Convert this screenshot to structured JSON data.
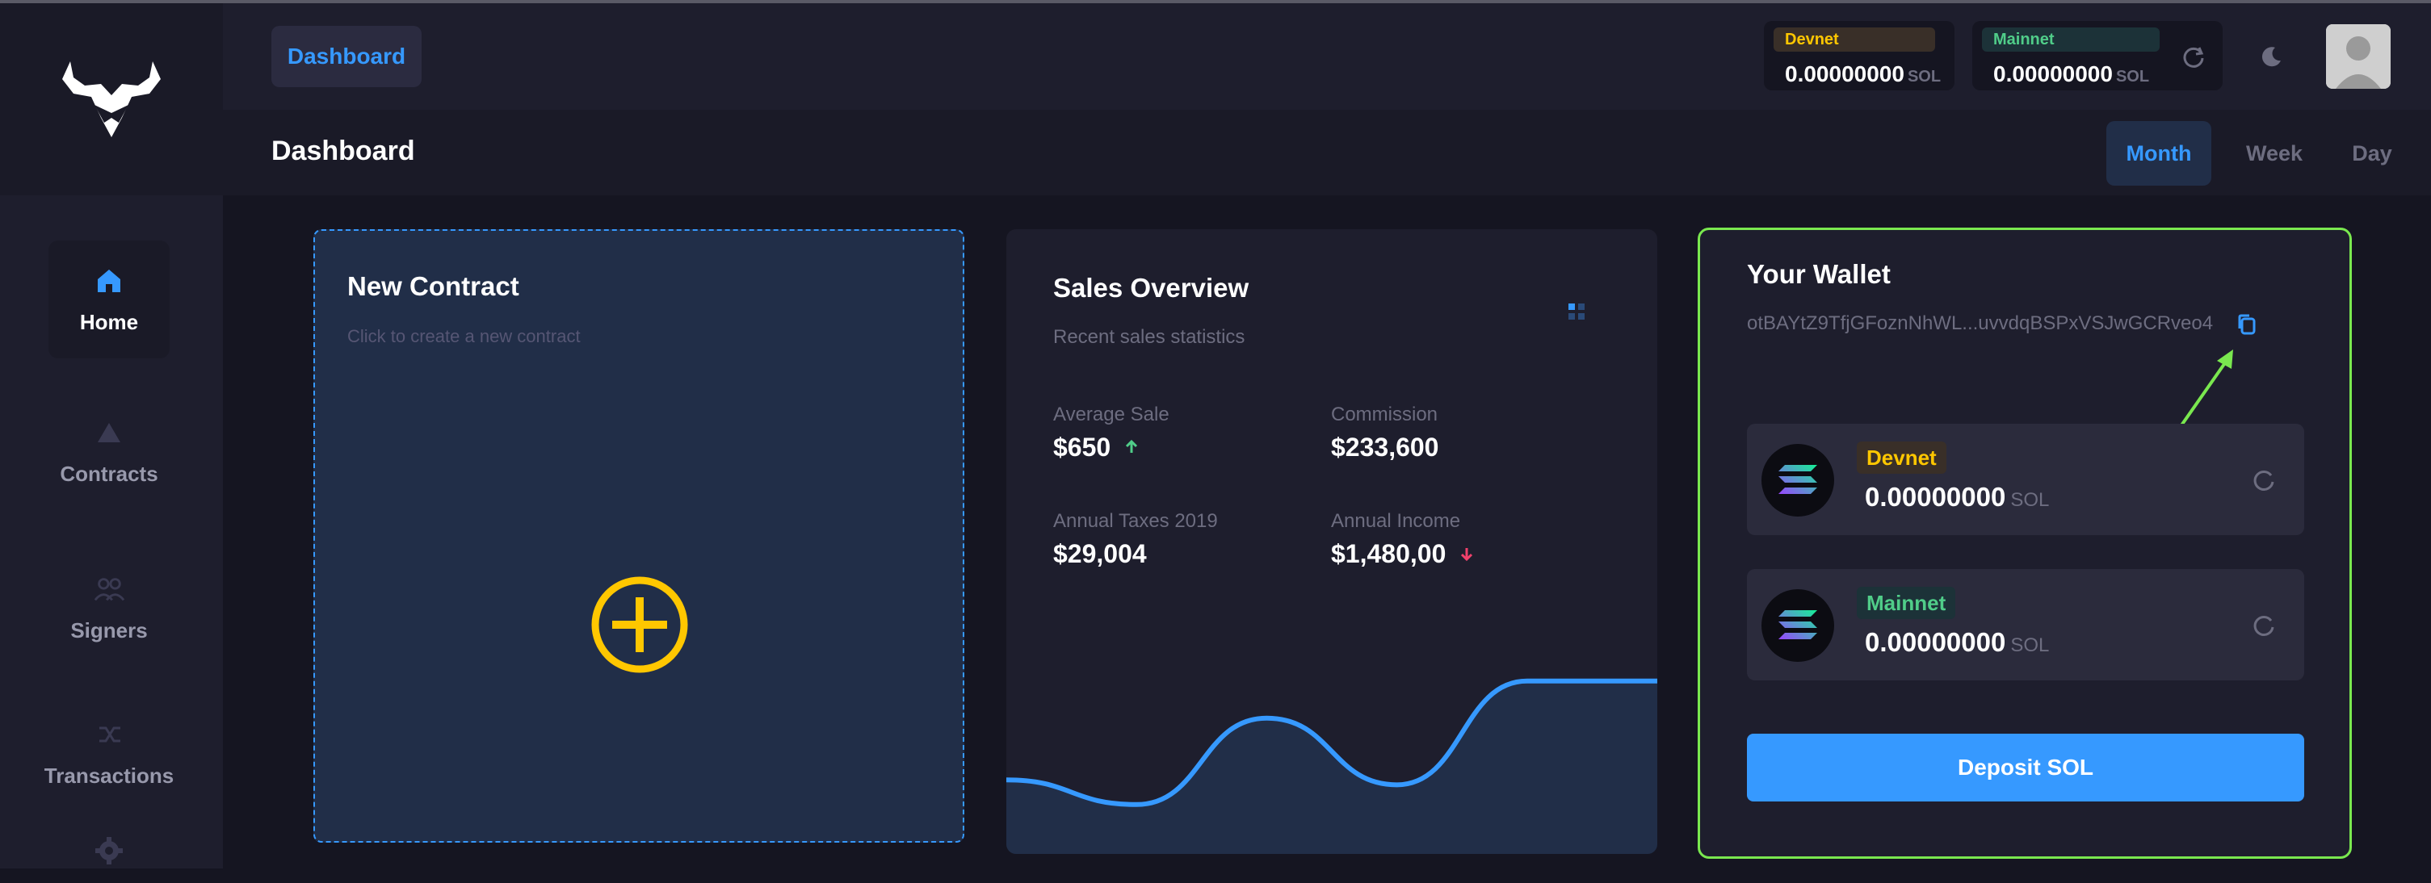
{
  "header": {
    "breadcrumb_button": "Dashboard",
    "devnet": {
      "label": "Devnet",
      "value": "0.00000000",
      "unit": "SOL"
    },
    "mainnet": {
      "label": "Mainnet",
      "value": "0.00000000",
      "unit": "SOL"
    }
  },
  "subheader": {
    "title": "Dashboard",
    "tabs": [
      {
        "label": "Month",
        "active": true
      },
      {
        "label": "Week",
        "active": false
      },
      {
        "label": "Day",
        "active": false
      }
    ]
  },
  "sidebar": {
    "items": [
      {
        "label": "Home",
        "icon": "home-icon",
        "active": true
      },
      {
        "label": "Contracts",
        "icon": "triangle-icon",
        "active": false
      },
      {
        "label": "Signers",
        "icon": "users-icon",
        "active": false
      },
      {
        "label": "Transactions",
        "icon": "shuffle-icon",
        "active": false
      },
      {
        "label": "",
        "icon": "gear-icon",
        "active": false
      }
    ]
  },
  "new_contract": {
    "title": "New Contract",
    "subtitle": "Click to create a new contract",
    "icon": "plus-circle-icon"
  },
  "sales": {
    "title": "Sales Overview",
    "subtitle": "Recent sales statistics",
    "stats": [
      {
        "label": "Average Sale",
        "value": "$650",
        "trend": "up"
      },
      {
        "label": "Commission",
        "value": "$233,600",
        "trend": ""
      },
      {
        "label": "Annual Taxes 2019",
        "value": "$29,004",
        "trend": ""
      },
      {
        "label": "Annual Income",
        "value": "$1,480,00",
        "trend": "down"
      }
    ]
  },
  "chart_data": {
    "type": "area",
    "title": "",
    "xlabel": "",
    "ylabel": "",
    "series": [
      {
        "values": [
          30,
          20,
          55,
          28,
          70,
          70
        ]
      }
    ],
    "ylim": [
      0,
      100
    ],
    "grid": false
  },
  "wallet": {
    "title": "Your Wallet",
    "address": "otBAYtZ9TfjGFoznNhWL...uvvdqBSPxVSJwGCRveo4",
    "networks": [
      {
        "label": "Devnet",
        "value": "0.00000000",
        "unit": "SOL"
      },
      {
        "label": "Mainnet",
        "value": "0.00000000",
        "unit": "SOL"
      }
    ],
    "deposit_label": "Deposit SOL"
  },
  "colors": {
    "accent": "#3699ff",
    "warning": "#ffc700",
    "success": "#50cd89",
    "danger": "#f1416c",
    "highlight": "#7ae84f"
  }
}
